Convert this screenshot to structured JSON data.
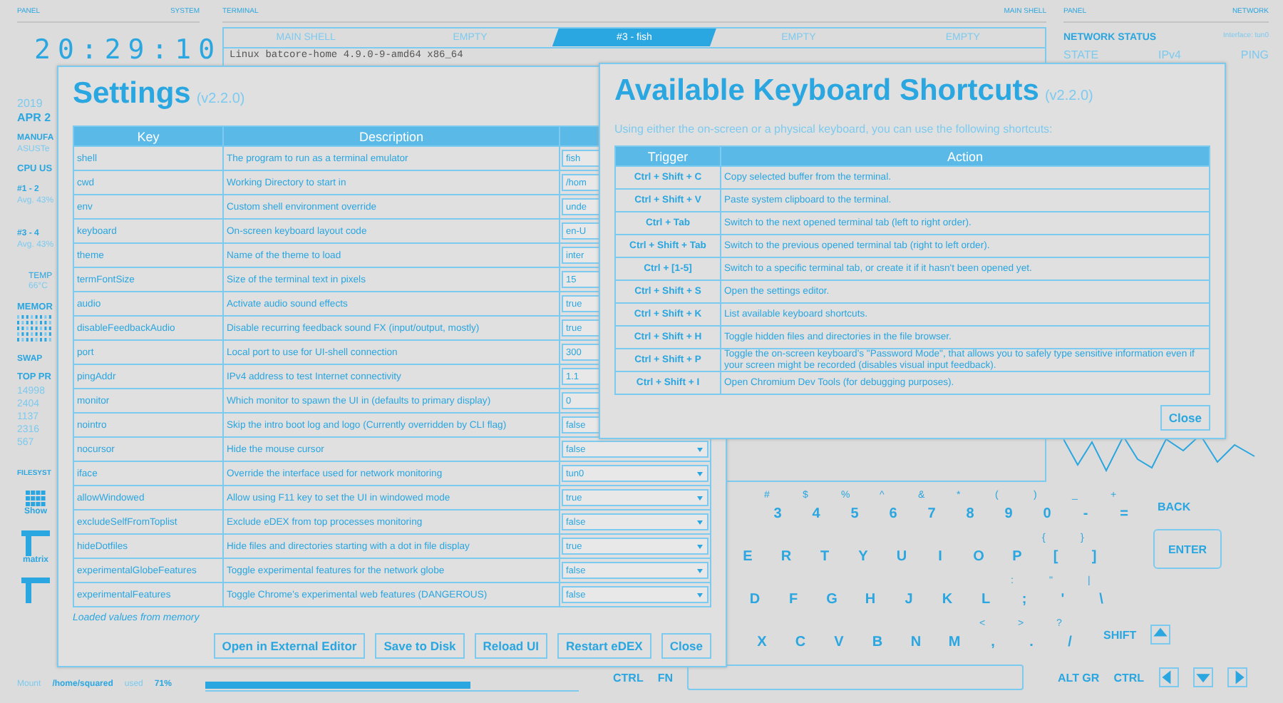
{
  "header": {
    "system": [
      "PANEL",
      "SYSTEM"
    ],
    "terminal": [
      "TERMINAL",
      "MAIN SHELL"
    ],
    "network": [
      "PANEL",
      "NETWORK"
    ]
  },
  "system": {
    "clock": "20:29:10",
    "year": "2019",
    "date": "APR 2",
    "manufacturer_label": "MANUFA",
    "manufacturer": "ASUSTe",
    "cpu_label": "CPU US",
    "cores": [
      {
        "name": "#1 - 2",
        "avg": "Avg. 43%"
      },
      {
        "name": "#3 - 4",
        "avg": "Avg. 43%"
      }
    ],
    "temp_label": "TEMP",
    "temp": "66°C",
    "memory_label": "MEMOR",
    "swap_label": "SWAP",
    "processes_label": "TOP PR",
    "processes": [
      "14998",
      "2404",
      "1137",
      "2316",
      "567"
    ]
  },
  "filesystem": {
    "label": "FILESYST",
    "items": [
      {
        "kind": "grid",
        "name": "Show"
      },
      {
        "kind": "file",
        "name": "matrix"
      },
      {
        "kind": "file"
      }
    ],
    "mount": "Mount",
    "path": "/home/squared",
    "used_label": "used",
    "used": "71%",
    "level": 0.71
  },
  "terminal": {
    "tabs": [
      {
        "label": "MAIN SHELL",
        "selected": false
      },
      {
        "label": "EMPTY",
        "selected": false
      },
      {
        "label": "#3 - fish",
        "selected": true
      },
      {
        "label": "EMPTY",
        "selected": false
      },
      {
        "label": "EMPTY",
        "selected": false
      }
    ],
    "lines": [
      "Linux batcore-home 4.9.0-9-amd64 x86_64"
    ]
  },
  "network": {
    "title": "NETWORK STATUS",
    "interface": "Interface: tun0",
    "columns": [
      "STATE",
      "IPv4",
      "PING"
    ]
  },
  "keyboard": {
    "rows": [
      [
        {
          "kind": "char",
          "shift": "#",
          "label": "3"
        },
        {
          "kind": "char",
          "shift": "$",
          "label": "4"
        },
        {
          "kind": "char",
          "shift": "%",
          "label": "5"
        },
        {
          "kind": "char",
          "shift": "^",
          "label": "6"
        },
        {
          "kind": "char",
          "shift": "&",
          "label": "7"
        },
        {
          "kind": "char",
          "shift": "*",
          "label": "8"
        },
        {
          "kind": "char",
          "shift": "(",
          "label": "9"
        },
        {
          "kind": "char",
          "shift": ")",
          "label": "0"
        },
        {
          "kind": "char",
          "shift": "_",
          "label": "-"
        },
        {
          "kind": "char",
          "shift": "+",
          "label": "="
        },
        {
          "kind": "wide",
          "label": "BACK"
        }
      ],
      [
        {
          "kind": "char",
          "label": "E"
        },
        {
          "kind": "char",
          "label": "R"
        },
        {
          "kind": "char",
          "label": "T"
        },
        {
          "kind": "char",
          "label": "Y"
        },
        {
          "kind": "char",
          "label": "U"
        },
        {
          "kind": "char",
          "label": "I"
        },
        {
          "kind": "char",
          "label": "O"
        },
        {
          "kind": "char",
          "label": "P"
        },
        {
          "kind": "char",
          "shift": "{",
          "label": "["
        },
        {
          "kind": "char",
          "shift": "}",
          "label": "]"
        },
        {
          "kind": "enter",
          "label": "ENTER"
        }
      ],
      [
        {
          "kind": "char",
          "label": "D"
        },
        {
          "kind": "char",
          "label": "F"
        },
        {
          "kind": "char",
          "label": "G"
        },
        {
          "kind": "char",
          "label": "H"
        },
        {
          "kind": "char",
          "label": "J"
        },
        {
          "kind": "char",
          "label": "K"
        },
        {
          "kind": "char",
          "label": "L"
        },
        {
          "kind": "char",
          "shift": ":",
          "label": ";"
        },
        {
          "kind": "char",
          "shift": "\"",
          "label": "'"
        },
        {
          "kind": "char",
          "shift": "|",
          "label": "\\"
        }
      ],
      [
        {
          "kind": "char",
          "label": "X"
        },
        {
          "kind": "char",
          "label": "C"
        },
        {
          "kind": "char",
          "label": "V"
        },
        {
          "kind": "char",
          "label": "B"
        },
        {
          "kind": "char",
          "label": "N"
        },
        {
          "kind": "char",
          "label": "M"
        },
        {
          "kind": "char",
          "shift": "<",
          "label": ","
        },
        {
          "kind": "char",
          "shift": ">",
          "label": "."
        },
        {
          "kind": "char",
          "shift": "?",
          "label": "/"
        },
        {
          "kind": "wide",
          "label": "SHIFT"
        },
        {
          "kind": "uparrow"
        }
      ],
      [
        {
          "kind": "wide",
          "label": "CTRL"
        },
        {
          "kind": "wide",
          "label": "FN"
        },
        {
          "kind": "space"
        },
        {
          "kind": "wide",
          "label": "ALT GR"
        },
        {
          "kind": "wide",
          "label": "CTRL"
        },
        {
          "kind": "leftarrow"
        },
        {
          "kind": "downarrow"
        },
        {
          "kind": "rightarrow"
        }
      ]
    ]
  },
  "settings": {
    "title": "Settings",
    "version": "(v2.2.0)",
    "columns": [
      "Key",
      "Description"
    ],
    "rows": [
      {
        "key": "shell",
        "description": "The program to run as a terminal emulator",
        "value": "fish"
      },
      {
        "key": "cwd",
        "description": "Working Directory to start in",
        "value": "/hom"
      },
      {
        "key": "env",
        "description": "Custom shell environment override",
        "value": "unde"
      },
      {
        "key": "keyboard",
        "description": "On-screen keyboard layout code",
        "value": "en-U"
      },
      {
        "key": "theme",
        "description": "Name of the theme to load",
        "value": "inter"
      },
      {
        "key": "termFontSize",
        "description": "Size of the terminal text in pixels",
        "value": "15"
      },
      {
        "key": "audio",
        "description": "Activate audio sound effects",
        "value": "true"
      },
      {
        "key": "disableFeedbackAudio",
        "description": "Disable recurring feedback sound FX (input/output, mostly)",
        "value": "true"
      },
      {
        "key": "port",
        "description": "Local port to use for UI-shell connection",
        "value": "300"
      },
      {
        "key": "pingAddr",
        "description": "IPv4 address to test Internet connectivity",
        "value": "1.1"
      },
      {
        "key": "monitor",
        "description": "Which monitor to spawn the UI in (defaults to primary display)",
        "value": "0"
      },
      {
        "key": "nointro",
        "description": "Skip the intro boot log and logo (Currently overridden by CLI flag)",
        "value": "false"
      },
      {
        "key": "nocursor",
        "description": "Hide the mouse cursor",
        "value": "false"
      },
      {
        "key": "iface",
        "description": "Override the interface used for network monitoring",
        "value": "tun0"
      },
      {
        "key": "allowWindowed",
        "description": "Allow using F11 key to set the UI in windowed mode",
        "value": "true"
      },
      {
        "key": "excludeSelfFromToplist",
        "description": "Exclude eDEX from top processes monitoring",
        "value": "false"
      },
      {
        "key": "hideDotfiles",
        "description": "Hide files and directories starting with a dot in file display",
        "value": "true"
      },
      {
        "key": "experimentalGlobeFeatures",
        "description": "Toggle experimental features for the network globe",
        "value": "false"
      },
      {
        "key": "experimentalFeatures",
        "description": "Toggle Chrome's experimental web features (DANGEROUS)",
        "value": "false"
      }
    ],
    "note": "Loaded values from memory",
    "buttons": [
      "Open in External Editor",
      "Save to Disk",
      "Reload UI",
      "Restart eDEX",
      "Close"
    ]
  },
  "shortcuts": {
    "title": "Available Keyboard Shortcuts",
    "version": "(v2.2.0)",
    "intro": "Using either the on-screen or a physical keyboard, you can use the following shortcuts:",
    "columns": [
      "Trigger",
      "Action"
    ],
    "rows": [
      {
        "trigger": "Ctrl + Shift + C",
        "action": "Copy selected buffer from the terminal."
      },
      {
        "trigger": "Ctrl + Shift + V",
        "action": "Paste system clipboard to the terminal."
      },
      {
        "trigger": "Ctrl + Tab",
        "action": "Switch to the next opened terminal tab (left to right order)."
      },
      {
        "trigger": "Ctrl + Shift + Tab",
        "action": "Switch to the previous opened terminal tab (right to left order)."
      },
      {
        "trigger": "Ctrl + [1-5]",
        "action": "Switch to a specific terminal tab, or create it if it hasn't been opened yet."
      },
      {
        "trigger": "Ctrl + Shift + S",
        "action": "Open the settings editor."
      },
      {
        "trigger": "Ctrl + Shift + K",
        "action": "List available keyboard shortcuts."
      },
      {
        "trigger": "Ctrl + Shift + H",
        "action": "Toggle hidden files and directories in the file browser."
      },
      {
        "trigger": "Ctrl + Shift + P",
        "action": "Toggle the on-screen keyboard's \"Password Mode\", that allows you to safely type sensitive information even if your screen might be recorded (disables visual input feedback)."
      },
      {
        "trigger": "Ctrl + Shift + I",
        "action": "Open Chromium Dev Tools (for debugging purposes)."
      }
    ],
    "close": "Close"
  }
}
